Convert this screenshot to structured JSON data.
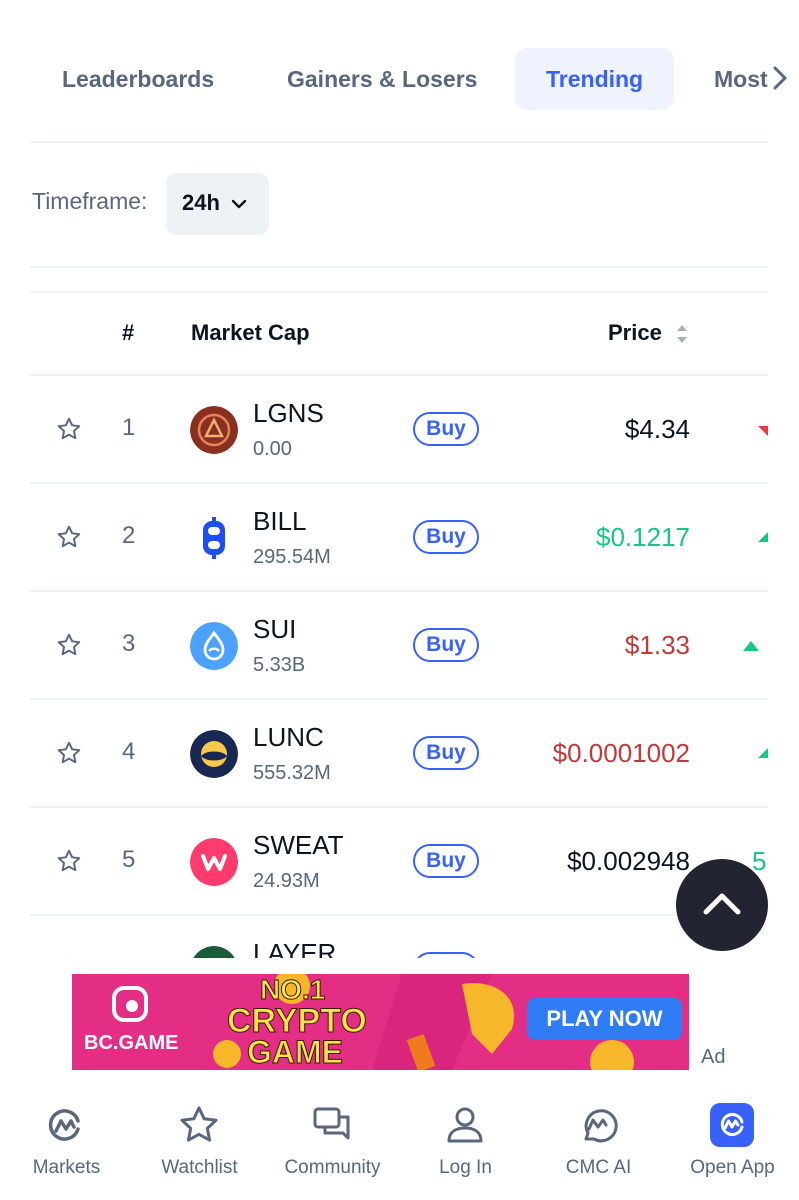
{
  "tabs": [
    {
      "label": "Leaderboards"
    },
    {
      "label": "Gainers & Losers"
    },
    {
      "label": "Trending"
    },
    {
      "label": "Most"
    }
  ],
  "timeframe": {
    "label": "Timeframe:",
    "value": "24h"
  },
  "table": {
    "headers": {
      "rank": "#",
      "market_cap": "Market Cap",
      "price": "Price"
    },
    "buy_label": "Buy",
    "rows": [
      {
        "rank": "1",
        "name": "LGNS",
        "market_cap": "0.00",
        "price": "$4.34",
        "price_color": "#0d1421",
        "trend": "down",
        "logo_color": "#8b2f1f"
      },
      {
        "rank": "2",
        "name": "BILL",
        "market_cap": "295.54M",
        "price": "$0.1217",
        "price_color": "#16c784",
        "trend": "up",
        "logo_color": "#1f4ef0"
      },
      {
        "rank": "3",
        "name": "SUI",
        "market_cap": "5.33B",
        "price": "$1.33",
        "price_color": "#c2393a",
        "trend": "up",
        "logo_color": "#4da2ff"
      },
      {
        "rank": "4",
        "name": "LUNC",
        "market_cap": "555.32M",
        "price": "$0.0001002",
        "price_color": "#c2393a",
        "trend": "up",
        "logo_color": "#172852"
      },
      {
        "rank": "5",
        "name": "SWEAT",
        "market_cap": "24.93M",
        "price": "$0.002948",
        "price_color": "#0d1421",
        "trend": "up",
        "change_text": "5",
        "logo_color": "#ff3a6c"
      },
      {
        "rank": "",
        "name": "LAYER",
        "market_cap": "",
        "price": "",
        "price_color": "#0d1421",
        "trend": "",
        "logo_color": "#1d5a3a"
      }
    ]
  },
  "ad": {
    "brand": "BC.GAME",
    "headline_1": "NO.1",
    "headline_2": "CRYPTO",
    "headline_3": "GAME",
    "cta": "PLAY NOW",
    "label": "Ad"
  },
  "bottom_nav": [
    {
      "label": "Markets",
      "icon": "cmc-logo-icon"
    },
    {
      "label": "Watchlist",
      "icon": "star-icon"
    },
    {
      "label": "Community",
      "icon": "chat-icon"
    },
    {
      "label": "Log In",
      "icon": "user-icon"
    },
    {
      "label": "CMC AI",
      "icon": "cmc-ai-icon"
    },
    {
      "label": "Open App",
      "icon": "open-app-icon"
    }
  ],
  "colors": {
    "accent": "#3861fb",
    "green": "#16c784",
    "red": "#c2393a",
    "text_muted": "#58667e"
  }
}
